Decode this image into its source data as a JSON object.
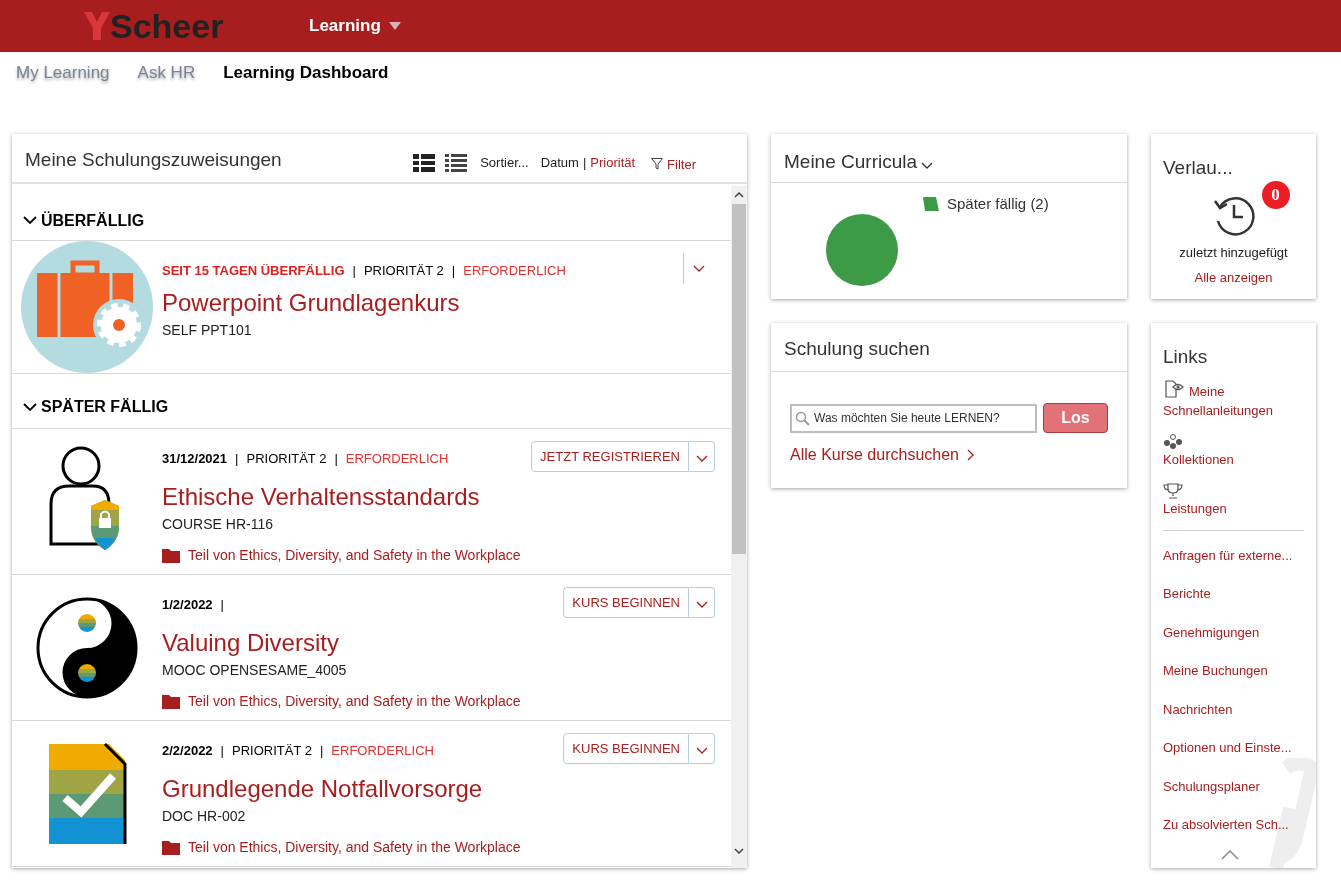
{
  "header": {
    "logo": "Scheer",
    "menu": "Learning"
  },
  "nav": [
    {
      "label": "My Learning",
      "selected": false
    },
    {
      "label": "Ask HR",
      "selected": false
    },
    {
      "label": "Learning Dashboard",
      "selected": true
    }
  ],
  "assignments": {
    "title": "Meine Schulungszuweisungen",
    "views": [
      {
        "kind": "cards",
        "selected": true
      },
      {
        "kind": "list",
        "selected": false
      }
    ],
    "sort_label": "Sortier...",
    "sort_options": [
      {
        "label": "Datum",
        "selected": false
      },
      {
        "label": "Priorität",
        "selected": true
      }
    ],
    "sort_separator": "|",
    "filter": "Filter",
    "sections": [
      {
        "title": "ÜBERFÄLLIG",
        "expanded": true,
        "items": [
          {
            "kind": "briefcase",
            "meta": [
              {
                "kind": "overdue",
                "text": "SEIT 15 TAGEN ÜBERFÄLLIG"
              },
              {
                "kind": "separator",
                "text": "|"
              },
              {
                "kind": "plain",
                "text": "PRIORITÄT 2"
              },
              {
                "kind": "separator",
                "text": "|"
              },
              {
                "kind": "required",
                "text": "ERFORDERLICH"
              }
            ],
            "title": "Powerpoint Grundlagenkurs",
            "code": "SELF PPT101"
          }
        ]
      },
      {
        "title": "SPÄTER FÄLLIG",
        "expanded": true,
        "items": [
          {
            "kind": "person",
            "meta": [
              {
                "kind": "date",
                "text": "31/12/2021"
              },
              {
                "kind": "separator",
                "text": "|"
              },
              {
                "kind": "plain",
                "text": "PRIORITÄT 2"
              },
              {
                "kind": "separator",
                "text": "|"
              },
              {
                "kind": "required",
                "text": "ERFORDERLICH"
              }
            ],
            "action": "JETZT REGISTRIEREN",
            "title": "Ethische Verhaltensstandards",
            "code": "COURSE HR-116",
            "curriculum": "Teil von Ethics, Diversity, and Safety in the Workplace"
          },
          {
            "kind": "yinyang",
            "meta": [
              {
                "kind": "date",
                "text": "1/2/2022"
              },
              {
                "kind": "separator",
                "text": "|"
              }
            ],
            "action": "KURS BEGINNEN",
            "title": "Valuing Diversity",
            "code": "MOOC OPENSESAME_4005",
            "curriculum": "Teil von Ethics, Diversity, and Safety in the Workplace"
          },
          {
            "kind": "document",
            "meta": [
              {
                "kind": "date",
                "text": "2/2/2022"
              },
              {
                "kind": "separator",
                "text": "|"
              },
              {
                "kind": "plain",
                "text": "PRIORITÄT 2"
              },
              {
                "kind": "separator",
                "text": "|"
              },
              {
                "kind": "required",
                "text": "ERFORDERLICH"
              }
            ],
            "action": "KURS BEGINNEN",
            "title": "Grundlegende Notfallvorsorge",
            "code": "DOC HR-002",
            "curriculum": "Teil von Ethics, Diversity, and Safety in the Workplace"
          }
        ]
      }
    ]
  },
  "curricula": {
    "title": "Meine Curricula",
    "legend": [
      {
        "label": "Später fällig (2)",
        "color": "#3d9a47"
      }
    ]
  },
  "history": {
    "title": "Verlau...",
    "badge": "0",
    "caption": "zuletzt hinzugefügt",
    "link": "Alle anzeigen"
  },
  "search": {
    "title": "Schulung suchen",
    "placeholder": "Was möchten Sie heute LERNEN?",
    "button": "Los",
    "browse": "Alle Kurse durchsuchen"
  },
  "links": {
    "title": "Links",
    "primary": [
      {
        "kind": "guide",
        "label": "Meine Schnellanleitungen"
      },
      {
        "kind": "dots",
        "label": "Kollektionen"
      },
      {
        "kind": "trophy",
        "label": "Leistungen"
      }
    ],
    "secondary": [
      "Anfragen für externe...",
      "Berichte",
      "Genehmigungen",
      "Meine Buchungen",
      "Nachrichten",
      "Optionen und Einste...",
      "Schulungsplaner",
      "Zu absolvierten Sch..."
    ]
  }
}
